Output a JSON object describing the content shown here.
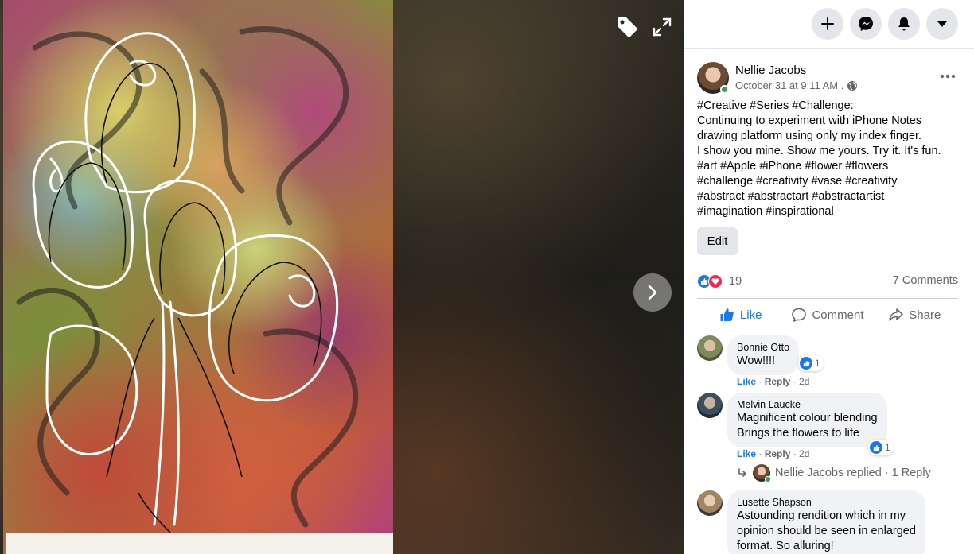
{
  "viewer": {
    "tag_icon": "tag-icon",
    "expand_icon": "expand-icon",
    "next_icon": "chevron-right-icon"
  },
  "topbar": {
    "buttons": [
      "plus-icon",
      "messenger-icon",
      "bell-icon",
      "caret-down-icon"
    ]
  },
  "post": {
    "author": "Nellie Jacobs",
    "timestamp": "October 31 at 9:11 AM .",
    "privacy_icon": "globe-icon",
    "text_lines": [
      "#Creative #Series #Challenge:",
      "Continuing to experiment with iPhone Notes",
      "drawing platform using only my index finger.",
      "I show you mine. Show me yours. Try it. It's fun.",
      "#art #Apple #iPhone #flower #flowers",
      "#challenge #creativity #vase #creativity",
      "#abstract #abstractart #abstractartist",
      "#imagination #inspirational"
    ],
    "edit_label": "Edit",
    "reaction_count": "19",
    "comments_count": "7 Comments",
    "actions": {
      "like": "Like",
      "comment": "Comment",
      "share": "Share"
    }
  },
  "comments": [
    {
      "name": "Bonnie Otto",
      "lines": [
        "Wow!!!!"
      ],
      "reactions": "1",
      "like": "Like",
      "reply": "Reply",
      "age": "2d"
    },
    {
      "name": "Melvin Laucke",
      "lines": [
        "Magnificent colour blending",
        "Brings the flowers to life"
      ],
      "reactions": "1",
      "like": "Like",
      "reply": "Reply",
      "age": "2d"
    },
    {
      "name": "Lusette Shapson",
      "lines": [
        "Astounding rendition which in my",
        "opinion should be seen in enlarged",
        "format. So alluring!"
      ]
    }
  ],
  "replied": {
    "text": "Nellie Jacobs replied · 1 Reply"
  },
  "colors": {
    "accent": "#1877f2",
    "love": "#f0284a",
    "online": "#31a24c"
  }
}
